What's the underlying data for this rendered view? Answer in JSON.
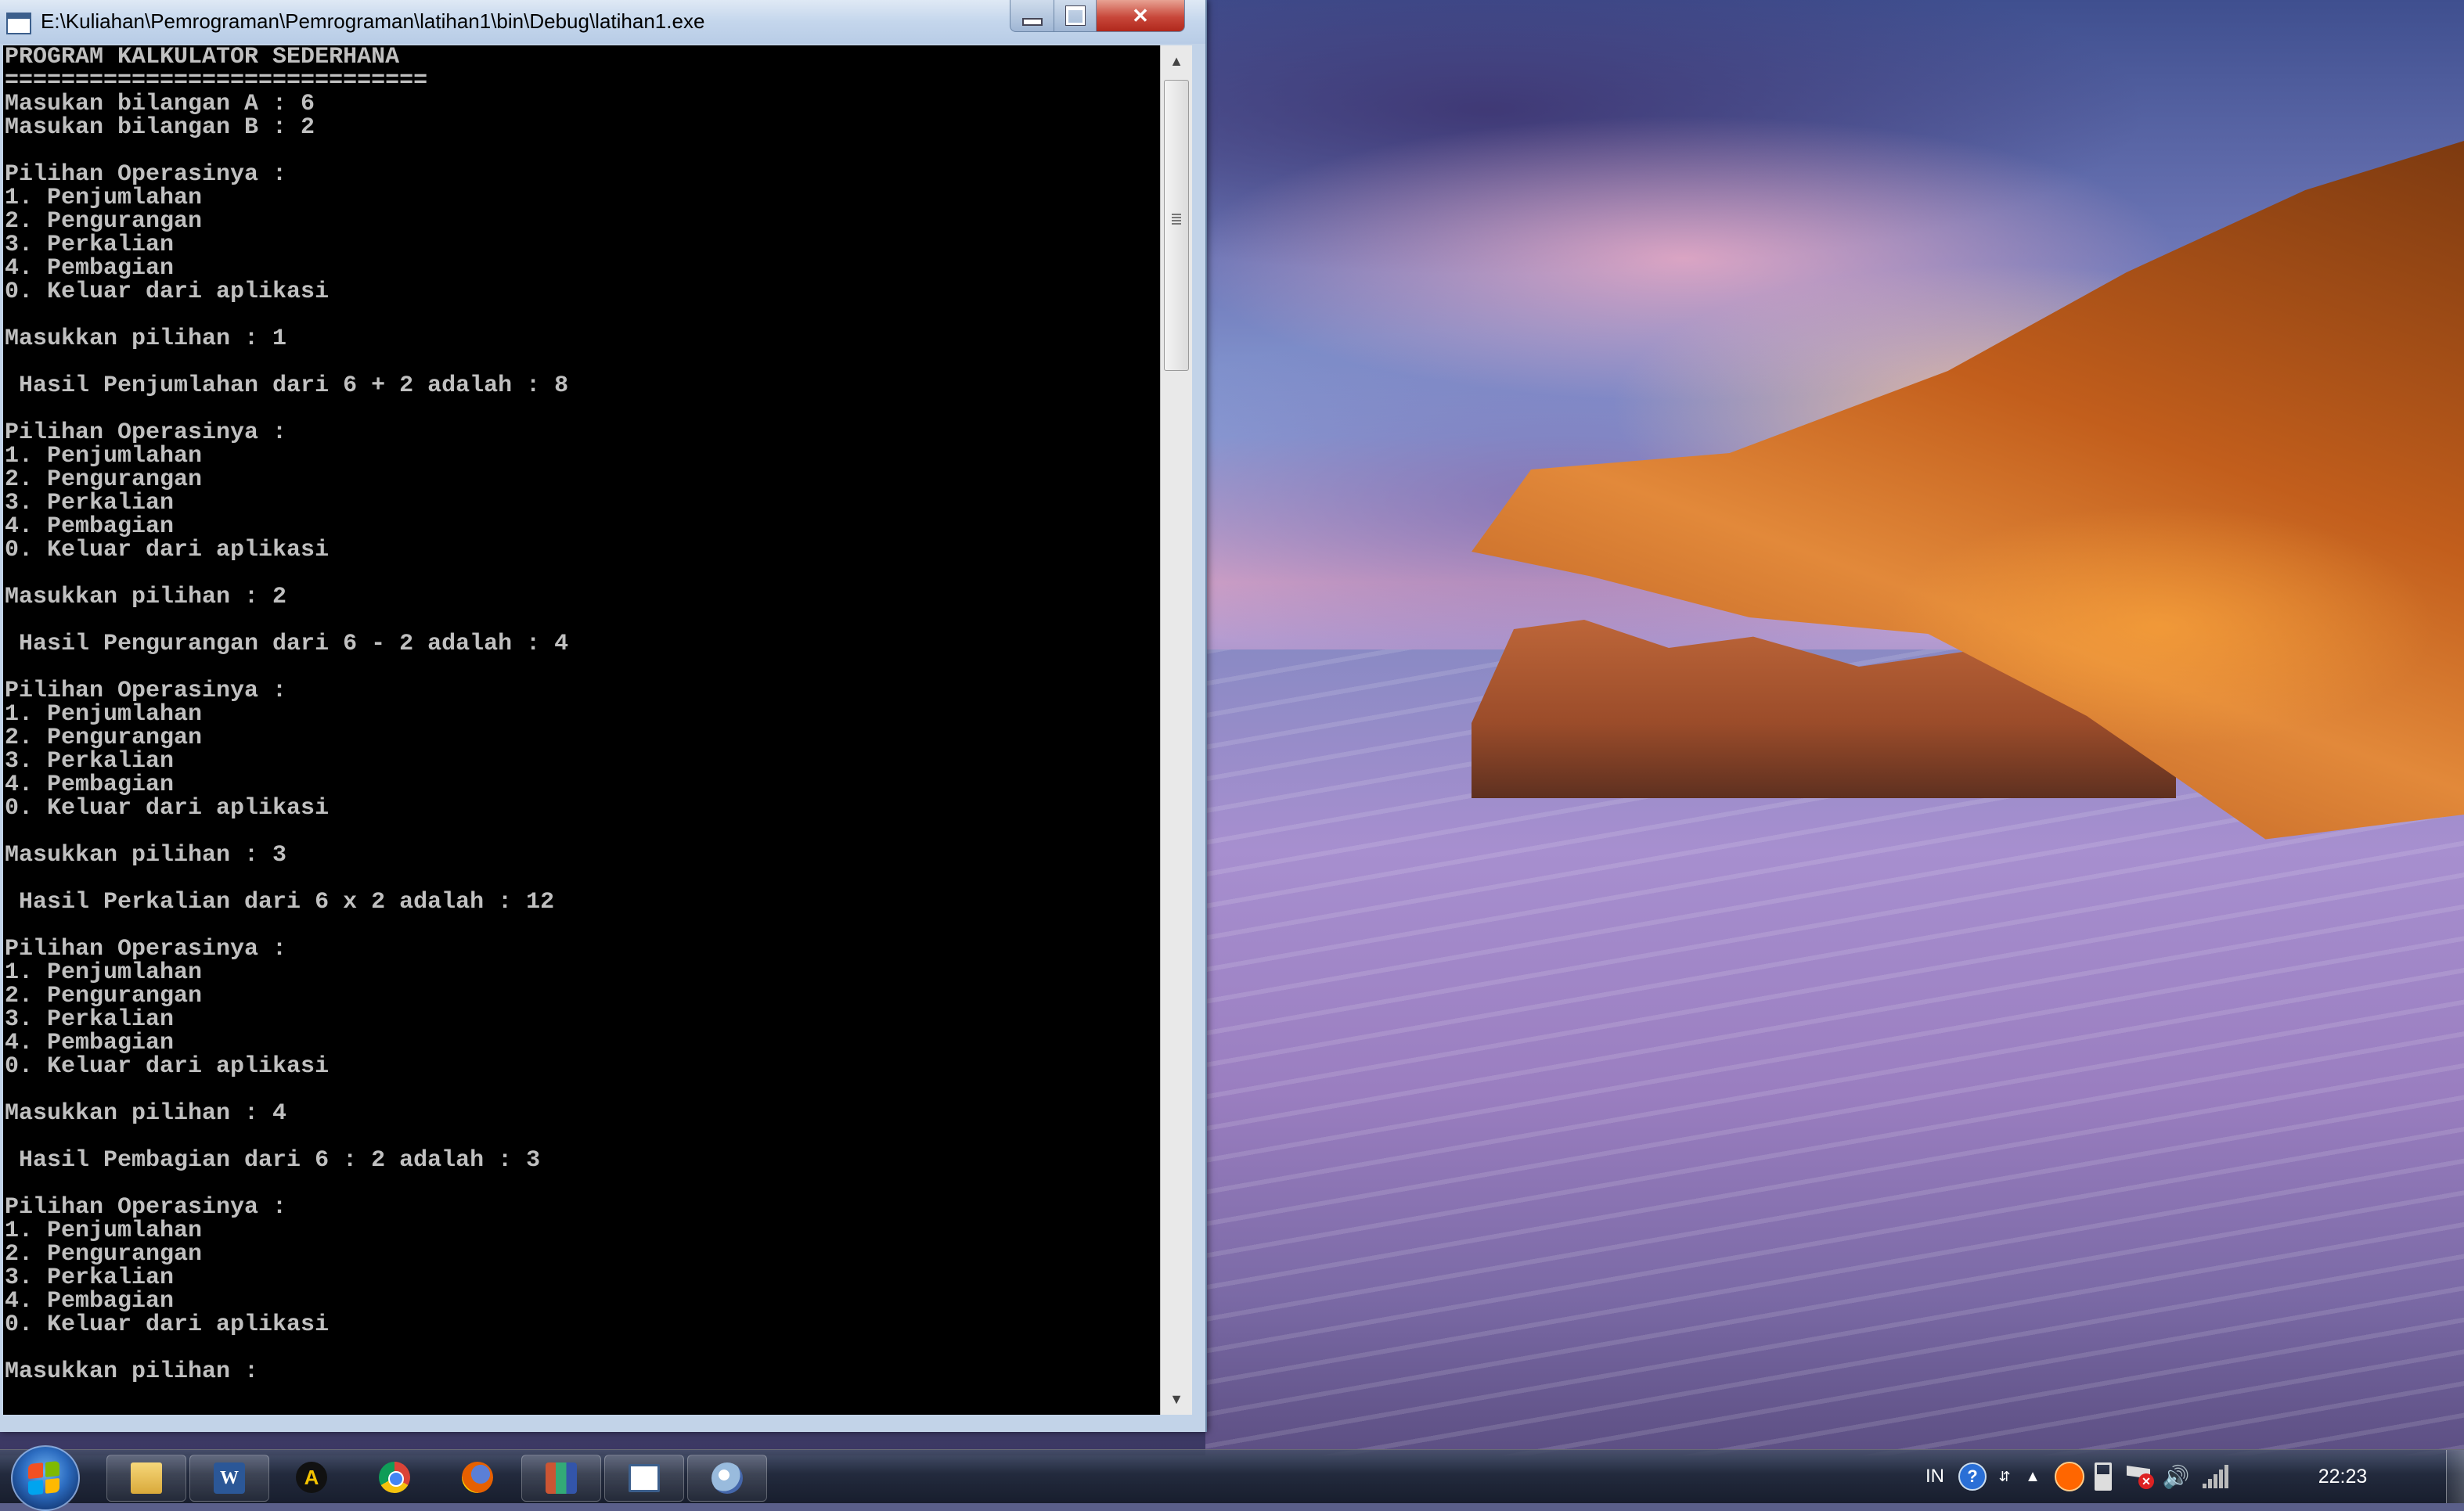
{
  "window": {
    "title": "E:\\Kuliahan\\Pemrograman\\Pemrograman\\latihan1\\bin\\Debug\\latihan1.exe",
    "minimize_glyph": "minimize-icon",
    "maximize_glyph": "restore-icon",
    "close_label": "✕"
  },
  "console": {
    "lines": [
      "PROGRAM KALKULATOR SEDERHANA",
      "==============================",
      "Masukan bilangan A : 6",
      "Masukan bilangan B : 2",
      "",
      "Pilihan Operasinya :",
      "1. Penjumlahan",
      "2. Pengurangan",
      "3. Perkalian",
      "4. Pembagian",
      "0. Keluar dari aplikasi",
      "",
      "Masukkan pilihan : 1",
      "",
      " Hasil Penjumlahan dari 6 + 2 adalah : 8",
      "",
      "Pilihan Operasinya :",
      "1. Penjumlahan",
      "2. Pengurangan",
      "3. Perkalian",
      "4. Pembagian",
      "0. Keluar dari aplikasi",
      "",
      "Masukkan pilihan : 2",
      "",
      " Hasil Pengurangan dari 6 - 2 adalah : 4",
      "",
      "Pilihan Operasinya :",
      "1. Penjumlahan",
      "2. Pengurangan",
      "3. Perkalian",
      "4. Pembagian",
      "0. Keluar dari aplikasi",
      "",
      "Masukkan pilihan : 3",
      "",
      " Hasil Perkalian dari 6 x 2 adalah : 12",
      "",
      "Pilihan Operasinya :",
      "1. Penjumlahan",
      "2. Pengurangan",
      "3. Perkalian",
      "4. Pembagian",
      "0. Keluar dari aplikasi",
      "",
      "Masukkan pilihan : 4",
      "",
      " Hasil Pembagian dari 6 : 2 adalah : 3",
      "",
      "Pilihan Operasinya :",
      "1. Penjumlahan",
      "2. Pengurangan",
      "3. Perkalian",
      "4. Pembagian",
      "0. Keluar dari aplikasi",
      "",
      "Masukkan pilihan : "
    ],
    "background_color": "#000000",
    "text_color": "#c0c0c0"
  },
  "scrollbar": {
    "up_arrow": "▲",
    "down_arrow": "▼"
  },
  "taskbar": {
    "start_icon": "windows-start-icon",
    "pinned": [
      {
        "icon": "folder-icon"
      },
      {
        "icon": "word-icon",
        "label": "W"
      },
      {
        "icon": "autocad-icon",
        "label": "A"
      },
      {
        "icon": "chrome-icon"
      },
      {
        "icon": "firefox-icon"
      },
      {
        "icon": "winrar-icon"
      },
      {
        "icon": "console-app-icon"
      },
      {
        "icon": "paint-icon"
      }
    ],
    "tray": {
      "language": "IN",
      "help": "?",
      "show_hidden": "▲",
      "volume": "🔊",
      "flag_alert": "✕",
      "clock": "22:23"
    }
  }
}
